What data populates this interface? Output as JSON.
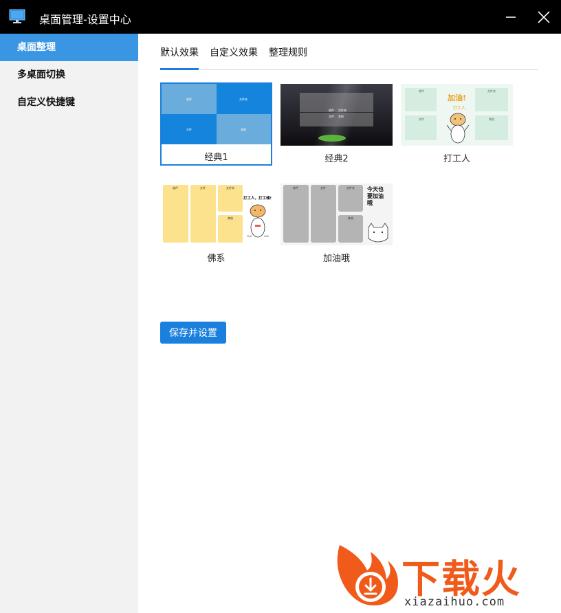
{
  "window": {
    "title": "桌面管理-设置中心"
  },
  "sidebar": {
    "items": [
      {
        "label": "桌面整理",
        "active": true
      },
      {
        "label": "多桌面切换",
        "active": false
      },
      {
        "label": "自定义快捷键",
        "active": false
      }
    ]
  },
  "tabs": [
    {
      "label": "默认效果",
      "active": true
    },
    {
      "label": "自定义效果",
      "active": false
    },
    {
      "label": "整理规则",
      "active": false
    }
  ],
  "themes": [
    {
      "label": "经典1",
      "selected": true,
      "cells": [
        "软件",
        "文件夹",
        "文件",
        "其他"
      ]
    },
    {
      "label": "经典2",
      "selected": false,
      "cells": [
        "软件",
        "文件夹",
        "文件",
        "其他"
      ]
    },
    {
      "label": "打工人",
      "selected": false,
      "cells": [
        "软件",
        "文件夹",
        "文件",
        "其他"
      ],
      "slogan": "加油!",
      "sub": "打工人"
    },
    {
      "label": "佛系",
      "selected": false,
      "cells": [
        "软件",
        "文件",
        "文件夹",
        "其他"
      ],
      "slogan": "打工人，打工魂!"
    },
    {
      "label": "加油哦",
      "selected": false,
      "cells": [
        "软件",
        "文件",
        "文件夹",
        "其他"
      ],
      "slogan": "今天也要加油哦"
    }
  ],
  "actions": {
    "save_label": "保存并设置"
  },
  "watermark": {
    "brand": "下载火",
    "url": "xiazaihuo.com"
  },
  "colors": {
    "accent": "#1a7fdd",
    "sidebar_active": "#3a95e3",
    "titlebar": "#000000"
  }
}
